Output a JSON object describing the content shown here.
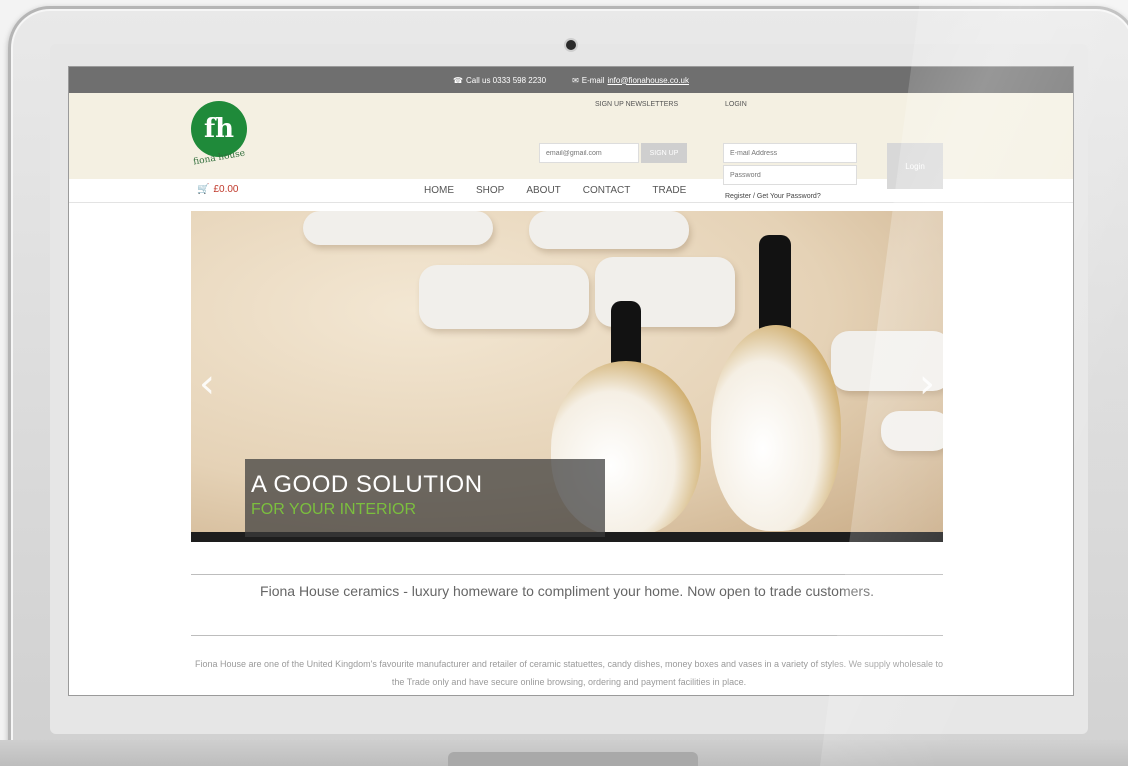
{
  "topbar": {
    "phone": "Call us 0333 598 2230",
    "email_prefix": "E-mail",
    "email": "info@fionahouse.co.uk"
  },
  "header": {
    "logo_mark": "fh",
    "logo_text": "fiona house",
    "newsletter_label": "SIGN UP NEWSLETTERS",
    "newsletter_placeholder": "email@gmail.com",
    "signup_label": "SIGN UP",
    "login_label": "LOGIN",
    "username_placeholder": "E-mail Address",
    "password_placeholder": "Password",
    "login_links": "Register / Get Your Password?",
    "login_button": "Login"
  },
  "navbar": {
    "cart_total": "£0.00",
    "items": [
      "HOME",
      "SHOP",
      "ABOUT",
      "CONTACT",
      "TRADE"
    ]
  },
  "hero": {
    "title": "A GOOD SOLUTION",
    "subtitle": "FOR YOUR INTERIOR",
    "prev_arrow": "‹",
    "next_arrow": "›"
  },
  "content": {
    "tagline": "Fiona House ceramics - luxury homeware to compliment your home. Now open to trade customers.",
    "paragraph": "Fiona House are one of the United Kingdom's favourite manufacturer and retailer of ceramic statuettes, candy dishes, money boxes and vases in a variety of styles. We supply wholesale to the Trade only and have secure online browsing, ordering and payment facilities in place."
  },
  "colors": {
    "topbar": "#6f6f6f",
    "header_bg": "#f4f0e2",
    "logo_green": "#1f8a3a",
    "accent_green": "#7bbf3e",
    "cart_red": "#c0392b"
  }
}
